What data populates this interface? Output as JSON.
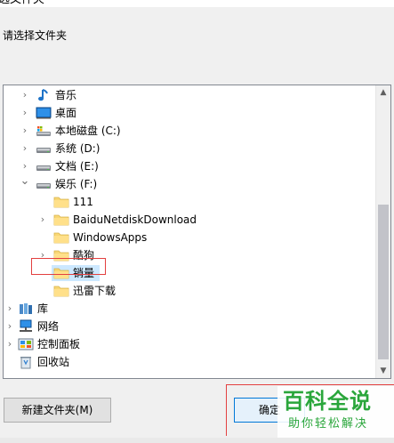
{
  "dialog": {
    "title": "选文件夹",
    "prompt": "请选择文件夹"
  },
  "tree": {
    "items": [
      {
        "label": "音乐",
        "icon": "music-note-icon",
        "expander": "collapsed"
      },
      {
        "label": "桌面",
        "icon": "desktop-icon",
        "expander": "collapsed"
      },
      {
        "label": "本地磁盘 (C:)",
        "icon": "system-drive-icon",
        "expander": "collapsed"
      },
      {
        "label": "系统 (D:)",
        "icon": "drive-icon",
        "expander": "collapsed"
      },
      {
        "label": "文档 (E:)",
        "icon": "drive-icon",
        "expander": "collapsed"
      },
      {
        "label": "娱乐 (F:)",
        "icon": "drive-icon",
        "expander": "expanded"
      },
      {
        "label": "111",
        "icon": "folder-icon",
        "expander": "none"
      },
      {
        "label": "BaiduNetdiskDownload",
        "icon": "folder-icon",
        "expander": "collapsed"
      },
      {
        "label": "WindowsApps",
        "icon": "folder-icon",
        "expander": "none"
      },
      {
        "label": "酷狗",
        "icon": "folder-icon",
        "expander": "collapsed"
      },
      {
        "label": "销量",
        "icon": "folder-icon",
        "expander": "none",
        "selected": true
      },
      {
        "label": "迅雷下载",
        "icon": "folder-icon",
        "expander": "none"
      },
      {
        "label": "库",
        "icon": "library-icon",
        "expander": "collapsed"
      },
      {
        "label": "网络",
        "icon": "network-icon",
        "expander": "collapsed"
      },
      {
        "label": "控制面板",
        "icon": "control-panel-icon",
        "expander": "collapsed"
      },
      {
        "label": "回收站",
        "icon": "recycle-bin-icon",
        "expander": "none"
      }
    ]
  },
  "buttons": {
    "new_folder": "新建文件夹(M)",
    "ok": "确定"
  },
  "watermark": {
    "main": "百科全说",
    "sub": "助你轻松解决"
  },
  "colors": {
    "selection": "#cce8ff",
    "annotation": "#e34040",
    "watermark": "#2aa63b",
    "folder": "#f8d775"
  }
}
